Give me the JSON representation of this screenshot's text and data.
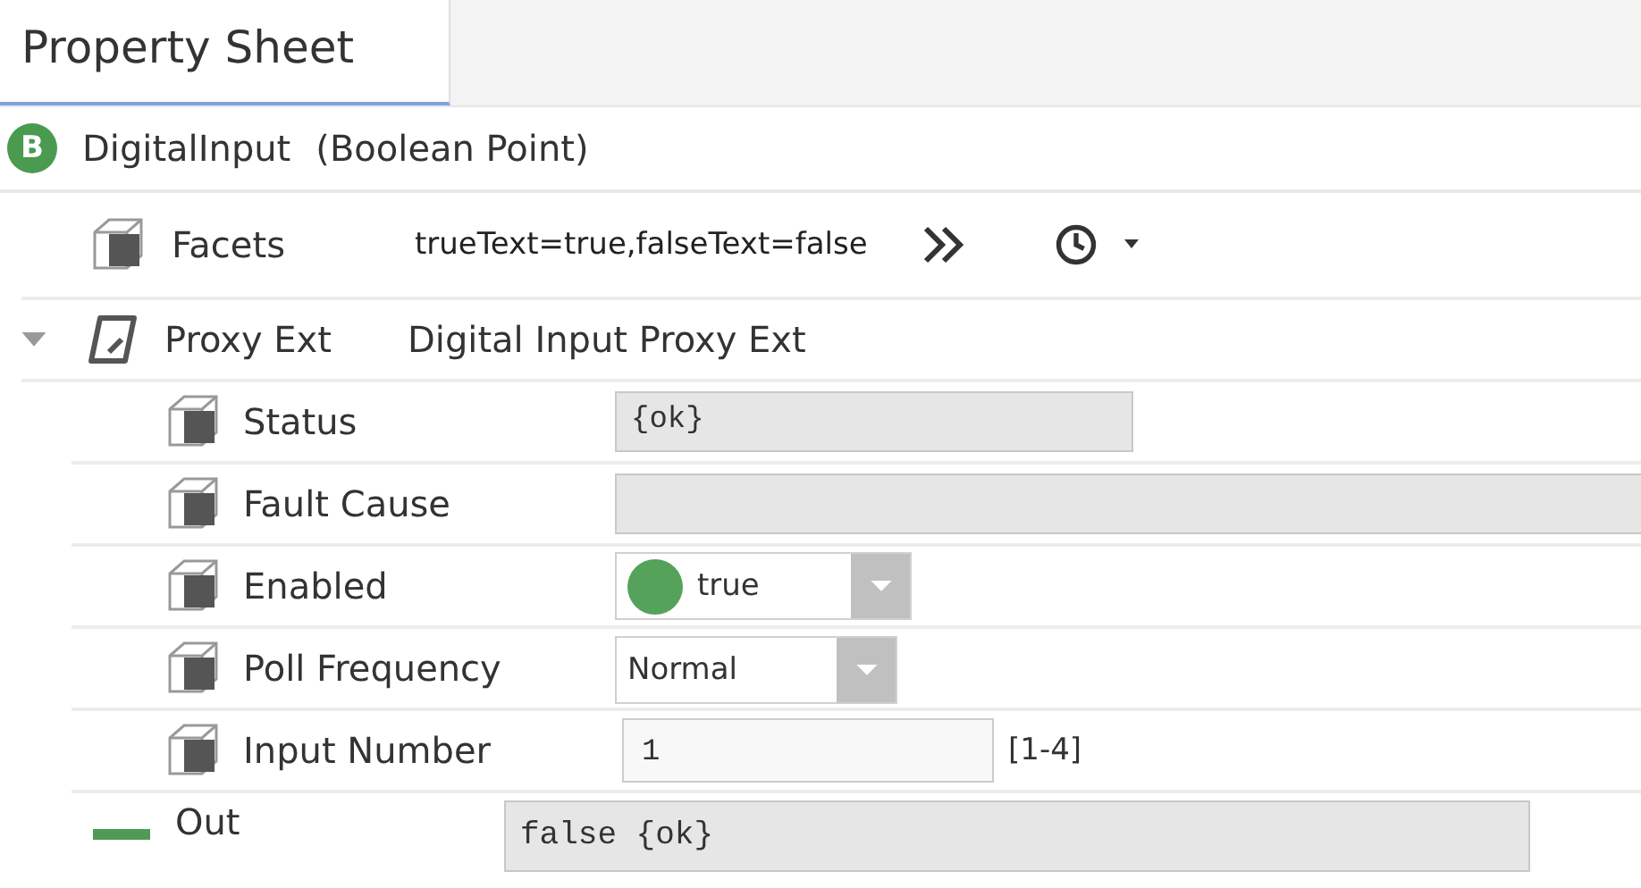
{
  "tabs": [
    {
      "label": "Property Sheet",
      "selected": true
    }
  ],
  "object": {
    "badge": "B",
    "name": "DigitalInput",
    "type": "(Boolean Point)"
  },
  "properties": [
    {
      "kind": "facets",
      "label": "Facets",
      "value": "trueText=true,falseText=false"
    },
    {
      "kind": "ext",
      "label": "Proxy Ext",
      "value": "Digital Input Proxy Ext",
      "expanded": true,
      "children": [
        {
          "kind": "readonly",
          "label": "Status",
          "value": "{ok}"
        },
        {
          "kind": "readonly-wide",
          "label": "Fault Cause"
        },
        {
          "kind": "boolean",
          "label": "Enabled",
          "value": "true",
          "on": true
        },
        {
          "kind": "enum",
          "label": "Poll Frequency",
          "value": "Normal"
        },
        {
          "kind": "number",
          "label": "Input Number",
          "value": "1",
          "range": "[1-4]"
        }
      ]
    },
    {
      "kind": "out",
      "label": "Out",
      "value": "false {ok}"
    }
  ]
}
